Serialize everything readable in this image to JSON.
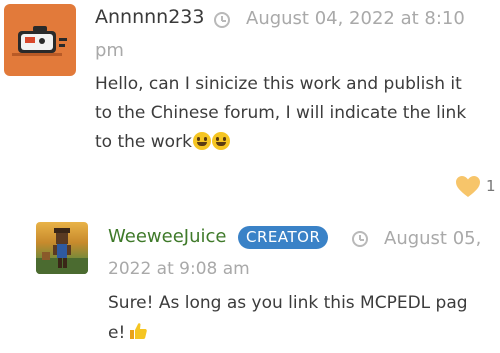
{
  "comment": {
    "author": "Annnnn233",
    "date_line1": "August 04, 2022 at 8:10",
    "date_line2": "pm",
    "body_lines": [
      "Hello, can I sinicize this work and publish it",
      "to the Chinese forum, I will indicate the link",
      "to the work"
    ],
    "like_count": "1",
    "colors": {
      "avatar_bg": "#e27a3a",
      "like": "#f7c56a"
    },
    "icons": {
      "time": "clock-icon",
      "like": "heart-like-icon",
      "emoji": "smiley-emoji"
    }
  },
  "reply": {
    "author": "WeeweeJuice",
    "badge": "CREATOR",
    "date_line1": "August 05,",
    "date_line2": "2022 at 9:08 am",
    "body_lines": [
      "Sure! As long as you link this MCPEDL pag",
      "e!"
    ],
    "colors": {
      "author": "#3f7a2a",
      "badge_bg": "#3a82c7"
    },
    "icons": {
      "time": "clock-icon",
      "emoji": "thumbs-up-emoji"
    }
  }
}
